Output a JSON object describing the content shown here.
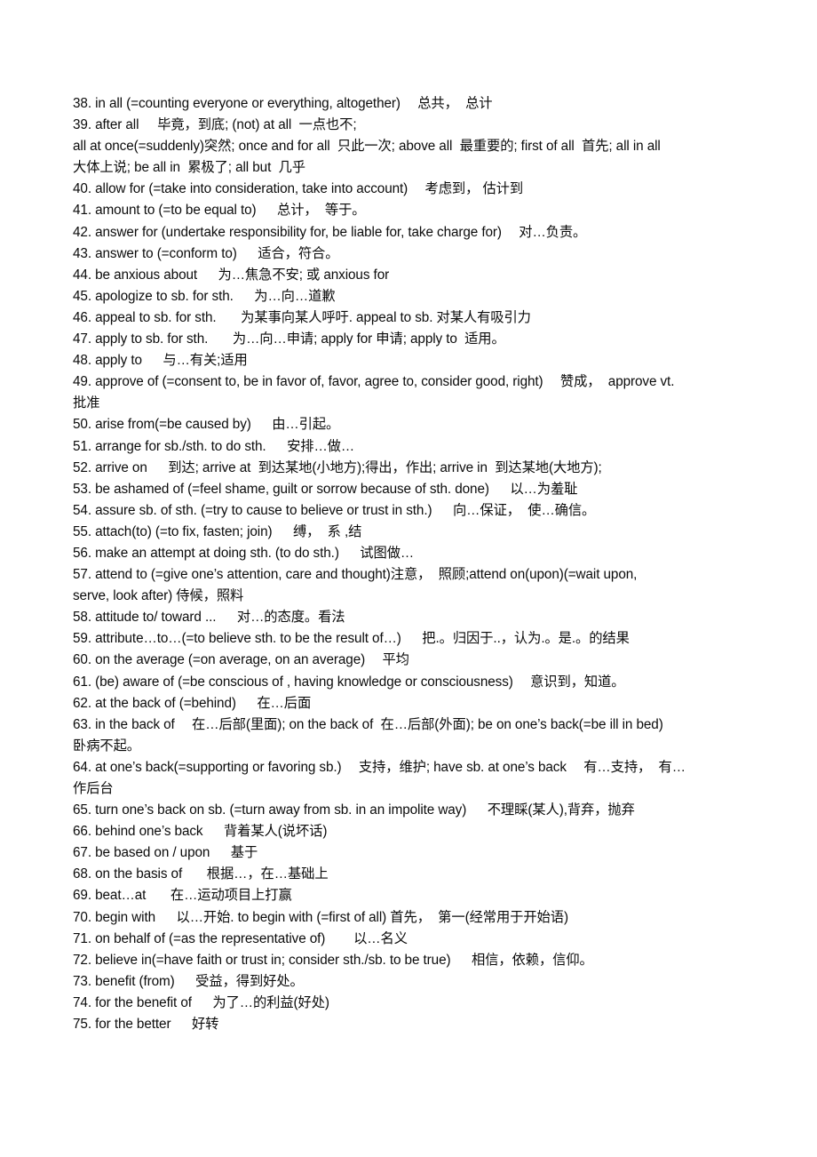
{
  "page": {
    "background_color": "#ffffff",
    "text_color": "#0b0b0b",
    "entries": [
      {
        "number": "38.",
        "text": " in all (=counting everyone or everything, altogether)  总共，  总计"
      },
      {
        "number": "39.",
        "text": " after all     毕竟，到底; (not) at all  一点也不;"
      },
      {
        "number": "",
        "text": "all at once(=suddenly)突然; once and for all  只此一次; above all  最重要的; first of all  首先; all in all"
      },
      {
        "number": "",
        "text": "大体上说; be all in  累极了; all but  几乎"
      },
      {
        "number": "40.",
        "text": " allow for (=take into consideration, take into account)  考虑到， 估计到"
      },
      {
        "number": "41.",
        "text": " amount to (=to be equal to)   总计，  等于。"
      },
      {
        "number": "42.",
        "text": " answer for (undertake responsibility for, be liable for, take charge for)  对…负责。"
      },
      {
        "number": "43.",
        "text": " answer to (=conform to)   适合，符合。"
      },
      {
        "number": "44.",
        "text": " be anxious about   为…焦急不安; 或 anxious for"
      },
      {
        "number": "45.",
        "text": " apologize to sb. for sth.   为…向…道歉"
      },
      {
        "number": "46.",
        "text": " appeal to sb. for sth.    为某事向某人呼吁. appeal to sb. 对某人有吸引力"
      },
      {
        "number": "47.",
        "text": " apply to sb. for sth.    为…向…申请; apply for 申请; apply to  适用。"
      },
      {
        "number": "48.",
        "text": " apply to   与…有关;适用"
      },
      {
        "number": "49.",
        "text": " approve of (=consent to, be in favor of, favor, agree to, consider good, right)  赞成，  approve vt."
      },
      {
        "number": "",
        "text": "批准"
      },
      {
        "number": "50.",
        "text": " arise from(=be caused by)   由…引起。"
      },
      {
        "number": "51.",
        "text": " arrange for sb./sth. to do sth.   安排…做…"
      },
      {
        "number": "52.",
        "text": " arrive on   到达; arrive at  到达某地(小地方);得出，作出; arrive in  到达某地(大地方);"
      },
      {
        "number": "53.",
        "text": " be ashamed of (=feel shame, guilt or sorrow because of sth. done)   以…为羞耻"
      },
      {
        "number": "54.",
        "text": " assure sb. of sth. (=try to cause to believe or trust in sth.)   向…保证，  使…确信。"
      },
      {
        "number": "55.",
        "text": " attach(to) (=to fix, fasten; join)   缚，  系 ,结"
      },
      {
        "number": "56.",
        "text": " make an attempt at doing sth. (to do sth.)   试图做…"
      },
      {
        "number": "57.",
        "text": " attend to (=give one’s attention, care and thought)注意，  照顾;attend on(upon)(=wait upon,"
      },
      {
        "number": "",
        "text": "serve, look after) 侍候，照料"
      },
      {
        "number": "58.",
        "text": " attitude to/ toward ...   对…的态度。看法"
      },
      {
        "number": "59.",
        "text": " attribute…to…(=to believe sth. to be the result of…)   把.。归因于..，认为.。是.。的结果"
      },
      {
        "number": "60.",
        "text": " on the average (=on average, on an average)  平均"
      },
      {
        "number": "61.",
        "text": " (be) aware of (=be conscious of , having knowledge or consciousness)  意识到，知道。"
      },
      {
        "number": "62.",
        "text": " at the back of (=behind)   在…后面"
      },
      {
        "number": "63.",
        "text": " in the back of  在…后部(里面); on the back of  在…后部(外面); be on one’s back(=be ill in bed)"
      },
      {
        "number": "",
        "text": "卧病不起。"
      },
      {
        "number": "64.",
        "text": " at one’s back(=supporting or favoring sb.)  支持，维护; have sb. at one’s back  有…支持，  有…"
      },
      {
        "number": "",
        "text": "作后台"
      },
      {
        "number": "65.",
        "text": " turn one’s back on sb. (=turn away from sb. in an impolite way)   不理睬(某人),背弃，抛弃"
      },
      {
        "number": "66.",
        "text": " behind one’s back   背着某人(说坏话)"
      },
      {
        "number": "67.",
        "text": " be based on / upon   基于"
      },
      {
        "number": "68.",
        "text": " on the basis of    根据…，在…基础上"
      },
      {
        "number": "69.",
        "text": " beat…at    在…运动项目上打赢"
      },
      {
        "number": "70.",
        "text": " begin with   以…开始. to begin with (=first of all) 首先，  第一(经常用于开始语)"
      },
      {
        "number": "71.",
        "text": " on behalf of (=as the representative of)     以…名义"
      },
      {
        "number": "72.",
        "text": " believe in(=have faith or trust in; consider sth./sb. to be true)   相信，依赖，信仰。"
      },
      {
        "number": "73.",
        "text": " benefit (from)   受益，得到好处。"
      },
      {
        "number": "74.",
        "text": " for the benefit of   为了…的利益(好处)"
      },
      {
        "number": "75.",
        "text": " for the better   好转"
      }
    ]
  }
}
